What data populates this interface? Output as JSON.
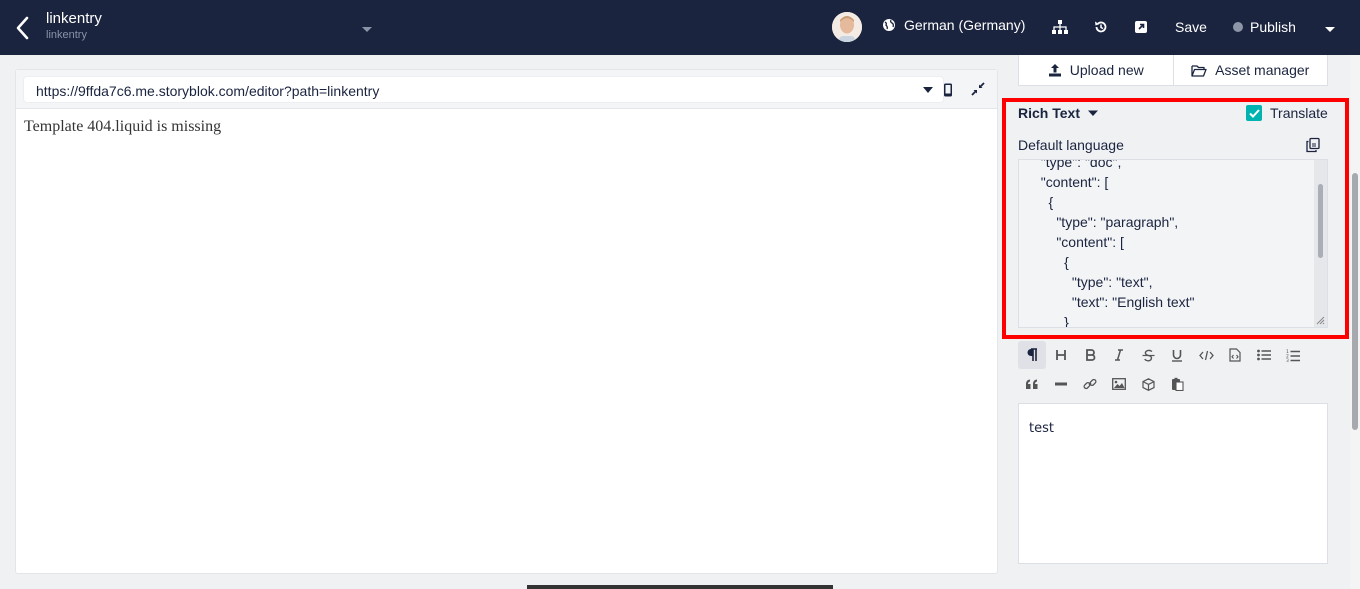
{
  "header": {
    "title": "linkentry",
    "subtitle": "linkentry",
    "language": "German (Germany)",
    "save_label": "Save",
    "publish_label": "Publish"
  },
  "preview": {
    "url": "https://9ffda7c6.me.storyblok.com/editor?path=linkentry",
    "message": "Template 404.liquid is missing"
  },
  "assets": {
    "upload_label": "Upload new",
    "manager_label": "Asset manager"
  },
  "field": {
    "title": "Rich Text",
    "translate_label": "Translate",
    "translate_checked": true,
    "default_language_label": "Default language",
    "code_lines": [
      "  \"type\": \"doc\",",
      "  \"content\": [",
      "    {",
      "      \"type\": \"paragraph\",",
      "      \"content\": [",
      "        {",
      "          \"type\": \"text\",",
      "          \"text\": \"English text\"",
      "        }"
    ],
    "editor_text": "test"
  },
  "colors": {
    "header_bg": "#1b243f",
    "accent_teal": "#00b3b0",
    "highlight_red": "#ff0000"
  }
}
